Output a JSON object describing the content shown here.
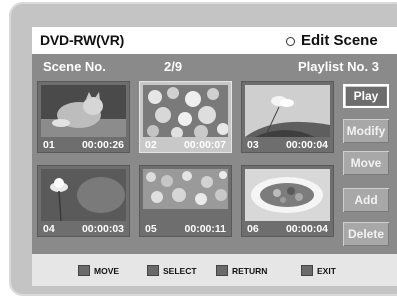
{
  "header": {
    "title": "DVD-RW(VR)",
    "screen_name": "Edit Scene"
  },
  "info": {
    "scene_label": "Scene No.",
    "page": "2/9",
    "playlist": "Playlist No. 3"
  },
  "scenes": [
    {
      "number": "01",
      "time": "00:00:26"
    },
    {
      "number": "02",
      "time": "00:00:07"
    },
    {
      "number": "03",
      "time": "00:00:04"
    },
    {
      "number": "04",
      "time": "00:00:03"
    },
    {
      "number": "05",
      "time": "00:00:11"
    },
    {
      "number": "06",
      "time": "00:00:04"
    }
  ],
  "selected_scene": "02",
  "buttons": {
    "play": "Play",
    "modify": "Modify",
    "move": "Move",
    "add": "Add",
    "delete": "Delete"
  },
  "active_button": "Play",
  "footer": {
    "move": "MOVE",
    "select": "SELECT",
    "return": "RETURN",
    "exit": "EXIT"
  }
}
